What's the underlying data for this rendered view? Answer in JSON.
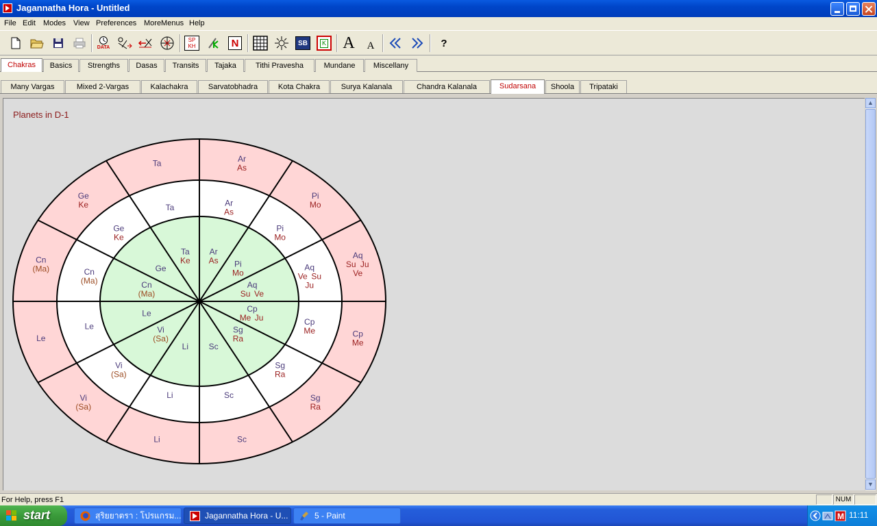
{
  "window": {
    "title": "Jagannatha Hora - Untitled"
  },
  "menu": [
    "File",
    "Edit",
    "Modes",
    "View",
    "Preferences",
    "MoreMenus",
    "Help"
  ],
  "toolbar": {
    "sp_kh": "SP KH",
    "n_label": "N",
    "sb_label": "SB",
    "k_label": "K",
    "font_large": "A",
    "font_small": "A",
    "help": "?",
    "data_label": "DATA"
  },
  "main_tabs": [
    {
      "label": "Chakras",
      "active": true
    },
    {
      "label": "Basics"
    },
    {
      "label": "Strengths"
    },
    {
      "label": "Dasas"
    },
    {
      "label": "Transits"
    },
    {
      "label": "Tajaka"
    },
    {
      "label": "Tithi Pravesha"
    },
    {
      "label": "Mundane"
    },
    {
      "label": "Miscellany"
    }
  ],
  "sub_tabs": [
    {
      "label": "Many Vargas"
    },
    {
      "label": "Mixed 2-Vargas"
    },
    {
      "label": "Kalachakra"
    },
    {
      "label": "Sarvatobhadra"
    },
    {
      "label": "Kota Chakra"
    },
    {
      "label": "Surya Kalanala"
    },
    {
      "label": "Chandra Kalanala"
    },
    {
      "label": "Sudarsana",
      "active": true
    },
    {
      "label": "Shoola"
    },
    {
      "label": "Tripataki"
    }
  ],
  "chart_title": "Planets in D-1",
  "colors": {
    "outer_ring": "#ffd6d6",
    "middle_ring": "#ffffff",
    "inner_ring": "#d8f8d8",
    "sign_text": "#4a3a7a",
    "planet_text": "#9b2020",
    "retro_text": "#9b4a20"
  },
  "chakra": {
    "outer": [
      {
        "signs": [
          "Ar"
        ],
        "planets": [
          "As"
        ]
      },
      {
        "signs": [
          "Pi"
        ],
        "planets": [
          "Mo"
        ]
      },
      {
        "signs": [
          "Aq"
        ],
        "planets": [
          "Su",
          "Ju",
          "Ve"
        ]
      },
      {
        "signs": [
          "Cp"
        ],
        "planets": [
          "Me"
        ]
      },
      {
        "signs": [
          "Sg"
        ],
        "planets": [
          "Ra"
        ]
      },
      {
        "signs": [
          "Sc"
        ],
        "planets": []
      },
      {
        "signs": [
          "Li"
        ],
        "planets": []
      },
      {
        "signs": [
          "Vi"
        ],
        "planets": [
          "(Sa)"
        ]
      },
      {
        "signs": [
          "Le"
        ],
        "planets": []
      },
      {
        "signs": [
          "Cn"
        ],
        "planets": [
          "(Ma)"
        ]
      },
      {
        "signs": [
          "Ge"
        ],
        "planets": [
          "Ke"
        ]
      },
      {
        "signs": [
          "Ta"
        ],
        "planets": []
      }
    ],
    "middle": [
      {
        "signs": [
          "Ta"
        ],
        "planets": []
      },
      {
        "signs": [
          "Ar"
        ],
        "planets": [
          "As"
        ]
      },
      {
        "signs": [
          "Pi"
        ],
        "planets": [
          "Mo"
        ]
      },
      {
        "signs": [
          "Aq"
        ],
        "planets": [
          "Ve",
          "Su",
          "Ju"
        ]
      },
      {
        "signs": [
          "Cp"
        ],
        "planets": [
          "Me"
        ]
      },
      {
        "signs": [
          "Sg"
        ],
        "planets": [
          "Ra"
        ]
      },
      {
        "signs": [
          "Sc"
        ],
        "planets": []
      },
      {
        "signs": [
          "Li"
        ],
        "planets": []
      },
      {
        "signs": [
          "Vi"
        ],
        "planets": [
          "(Sa)"
        ]
      },
      {
        "signs": [
          "Le"
        ],
        "planets": []
      },
      {
        "signs": [
          "Cn"
        ],
        "planets": [
          "(Ma)"
        ]
      },
      {
        "signs": [
          "Ge"
        ],
        "planets": [
          "Ke"
        ]
      }
    ],
    "inner": [
      {
        "signs": [
          "Ta"
        ],
        "planets": [
          "Ke"
        ]
      },
      {
        "signs": [
          "Ar"
        ],
        "planets": [
          "As"
        ]
      },
      {
        "signs": [
          "Pi"
        ],
        "planets": [
          "Mo"
        ]
      },
      {
        "signs": [
          "Aq"
        ],
        "planets": [
          "Su",
          "Ve"
        ]
      },
      {
        "signs": [
          "Cp"
        ],
        "planets": [
          "Me",
          "Ju"
        ]
      },
      {
        "signs": [
          "Sg"
        ],
        "planets": [
          "Ra"
        ]
      },
      {
        "signs": [
          "Sc"
        ],
        "planets": []
      },
      {
        "signs": [
          "Li"
        ],
        "planets": []
      },
      {
        "signs": [
          "Vi"
        ],
        "planets": [
          "(Sa)"
        ]
      },
      {
        "signs": [
          "Le"
        ],
        "planets": []
      },
      {
        "signs": [
          "Cn"
        ],
        "planets": [
          "(Ma)"
        ]
      },
      {
        "signs": [
          "Ge"
        ],
        "planets": []
      }
    ]
  },
  "status": {
    "help": "For Help, press F1",
    "num": "NUM"
  },
  "taskbar": {
    "start": "start",
    "tasks": [
      {
        "label": "สุริยยาตรา : โปรแกรม..."
      },
      {
        "label": "Jagannatha Hora - U...",
        "active": true
      },
      {
        "label": "5 - Paint"
      }
    ],
    "clock": "11:11"
  }
}
